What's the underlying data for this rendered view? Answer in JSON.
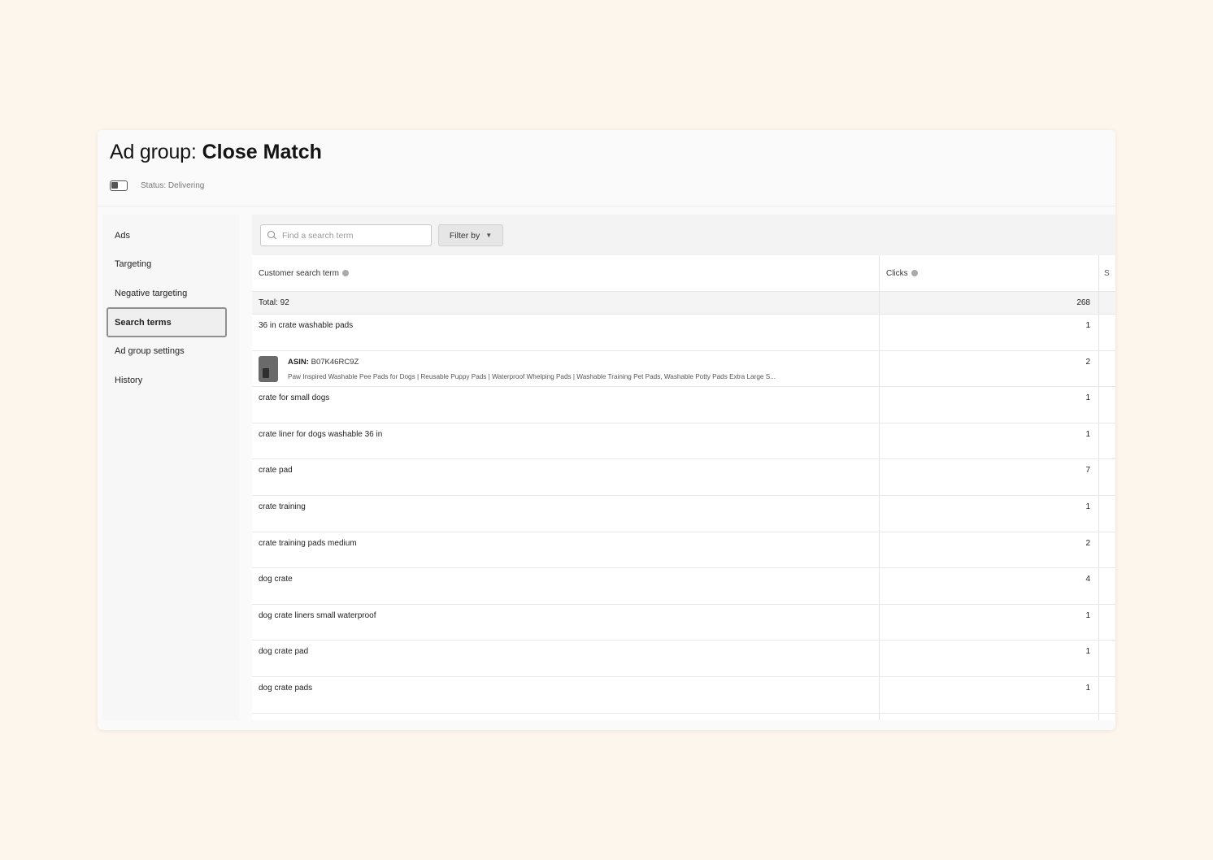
{
  "header": {
    "title_prefix": "Ad group:",
    "title_name": "Close Match",
    "status_text": "Status: Delivering"
  },
  "sidebar": {
    "items": [
      {
        "label": "Ads",
        "active": false
      },
      {
        "label": "Targeting",
        "active": false
      },
      {
        "label": "Negative targeting",
        "active": false
      },
      {
        "label": "Search terms",
        "active": true
      },
      {
        "label": "Ad group settings",
        "active": false
      },
      {
        "label": "History",
        "active": false
      }
    ]
  },
  "toolbar": {
    "search_placeholder": "Find a search term",
    "filter_label": "Filter by"
  },
  "table": {
    "columns": [
      "Customer search term",
      "Clicks",
      "S"
    ],
    "total_label": "Total: 92",
    "total_clicks": "268",
    "rows": [
      {
        "term": "36 in crate washable pads",
        "clicks": "1"
      },
      {
        "asin_label": "ASIN:",
        "asin_value": "B07K46RC9Z",
        "description": "Paw Inspired Washable Pee Pads for Dogs | Reusable Puppy Pads | Waterproof Whelping Pads | Washable Training Pet Pads, Washable Potty Pads Extra Large S...",
        "clicks": "2"
      },
      {
        "term": "crate for small dogs",
        "clicks": "1"
      },
      {
        "term": "crate liner for dogs washable 36 in",
        "clicks": "1"
      },
      {
        "term": "crate pad",
        "clicks": "7"
      },
      {
        "term": "crate training",
        "clicks": "1"
      },
      {
        "term": "crate training pads medium",
        "clicks": "2"
      },
      {
        "term": "dog crate",
        "clicks": "4"
      },
      {
        "term": "dog crate liners small waterproof",
        "clicks": "1"
      },
      {
        "term": "dog crate pad",
        "clicks": "1"
      },
      {
        "term": "dog crate pads",
        "clicks": "1"
      }
    ]
  },
  "colors": {
    "background": "#fdf6ec",
    "card": "#fafafa",
    "active_border": "#8f8f8f"
  }
}
